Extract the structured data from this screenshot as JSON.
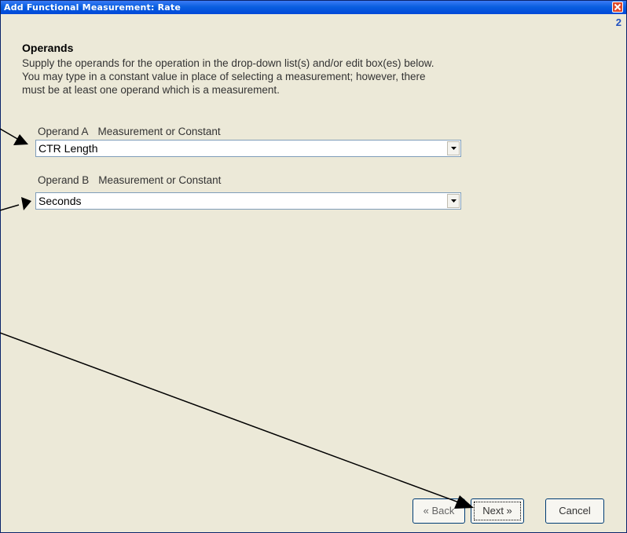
{
  "window": {
    "title": "Add Functional Measurement: Rate",
    "step_number": "2"
  },
  "content": {
    "heading": "Operands",
    "description_lines": [
      "Supply the operands for the operation in the drop-down list(s) and/or edit box(es) below.",
      "You may type in a constant value in place of selecting a measurement; however, there",
      "must be at least one operand which is a measurement."
    ]
  },
  "operand_a": {
    "name": "Operand A",
    "type_label": "Measurement or Constant",
    "value": "CTR Length"
  },
  "operand_b": {
    "name": "Operand B",
    "type_label": "Measurement or Constant",
    "value": "Seconds"
  },
  "buttons": {
    "back": "« Back",
    "next": "Next »",
    "cancel": "Cancel"
  },
  "icons": {
    "close": "close-x-icon",
    "dropdown": "triangle-down-icon"
  },
  "colors": {
    "titlebar": "#0a5fe0",
    "window_bg": "#ece9d8",
    "close_button": "#e04a2c",
    "step_number": "#2050c0"
  }
}
